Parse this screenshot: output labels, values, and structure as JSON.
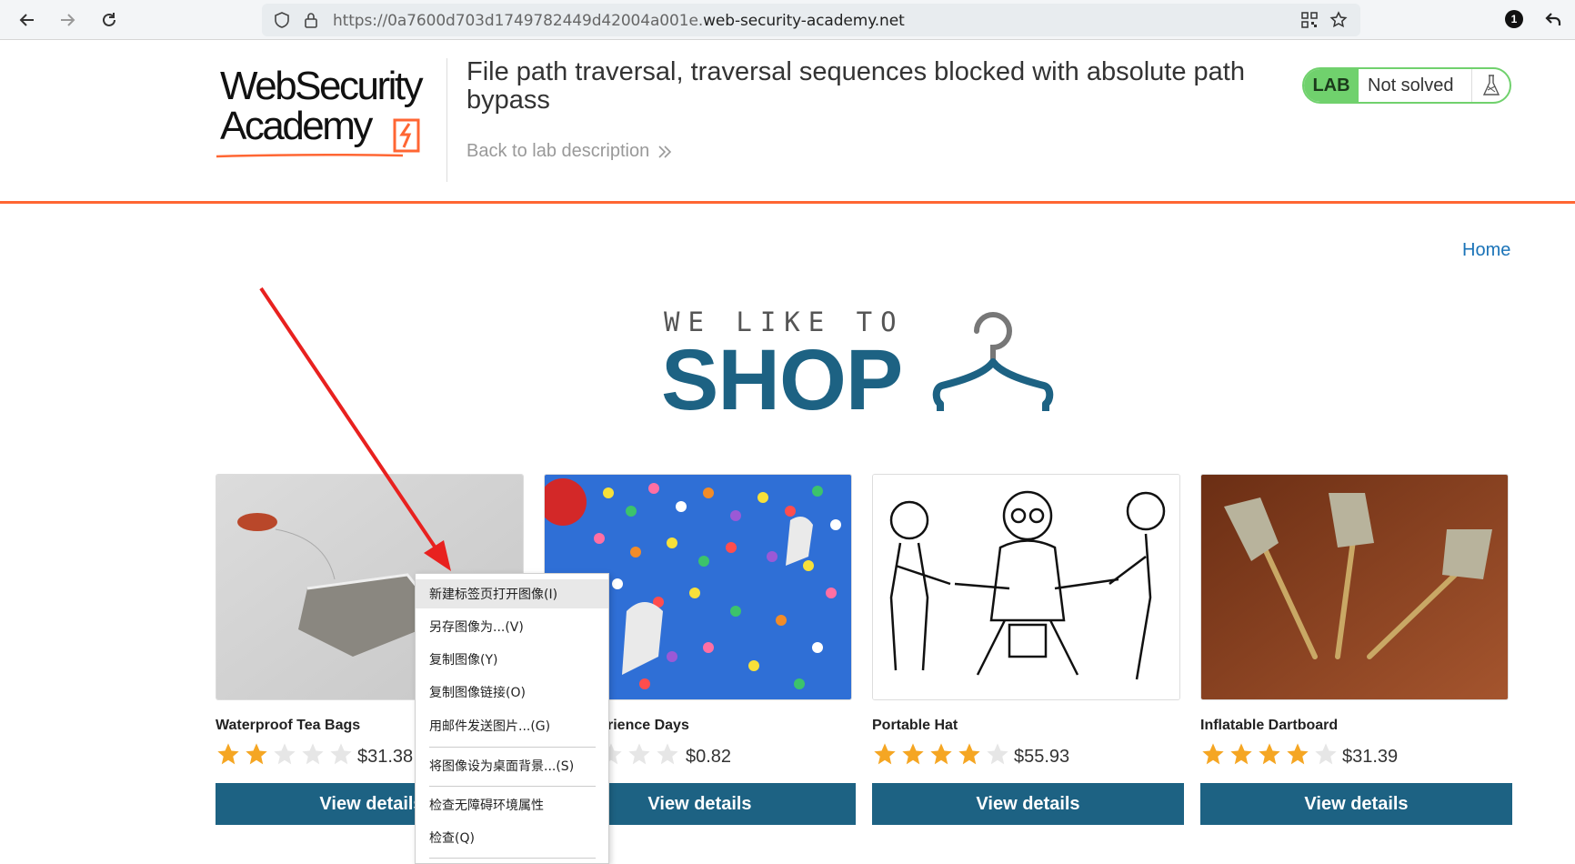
{
  "browser": {
    "url_prefix": "https://0a7600d703d1749782449d42004a001e.",
    "url_host": "web-security-academy.net",
    "notification_count": "1"
  },
  "lab": {
    "logo_line1": "WebSecurity",
    "logo_line2": "Academy",
    "title": "File path traversal, traversal sequences blocked with absolute path bypass",
    "back_link": "Back to lab description",
    "badge": "LAB",
    "status": "Not solved"
  },
  "nav": {
    "home": "Home"
  },
  "hero": {
    "top": "WE LIKE TO",
    "big": "SHOP"
  },
  "colors": {
    "accent_orange": "#ff6633",
    "brand_blue": "#1d6283",
    "lab_green": "#70d16d",
    "star": "#f5a623"
  },
  "products": [
    {
      "name": "Waterproof Tea Bags",
      "rating": 2,
      "price": "$31.38",
      "button": "View details"
    },
    {
      "name": "Experience Days",
      "name_visible": "rience Days",
      "rating": 2,
      "price": "$0.82",
      "button": "View details"
    },
    {
      "name": "Portable Hat",
      "rating": 4,
      "price": "$55.93",
      "button": "View details"
    },
    {
      "name": "Inflatable Dartboard",
      "rating": 4,
      "price": "$31.39",
      "button": "View details"
    }
  ],
  "context_menu": {
    "items": [
      "新建标签页打开图像(I)",
      "另存图像为...(V)",
      "复制图像(Y)",
      "复制图像链接(O)",
      "用邮件发送图片...(G)",
      "将图像设为桌面背景...(S)",
      "检查无障碍环境属性",
      "检查(Q)"
    ]
  }
}
